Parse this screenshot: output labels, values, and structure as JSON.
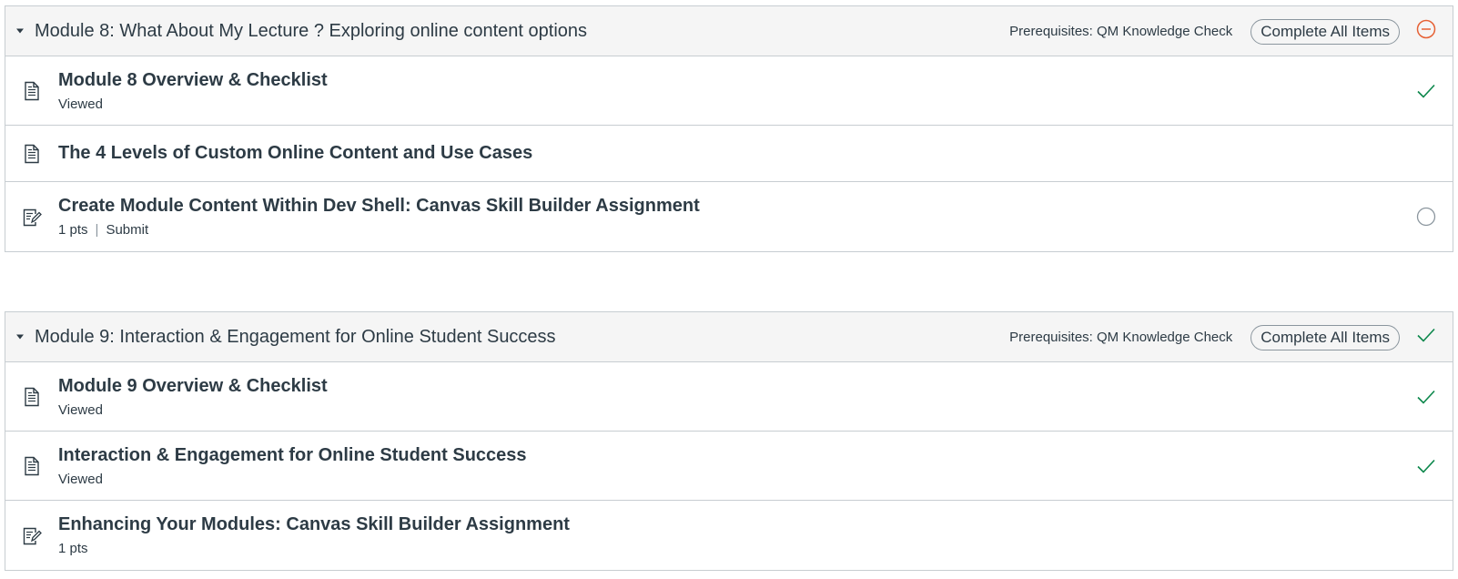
{
  "colors": {
    "complete": "#0b874b",
    "warning": "#e66135",
    "header_bg": "#f5f5f5",
    "border": "#c7cdd1",
    "text": "#2d3b45"
  },
  "modules": [
    {
      "title": "Module 8: What About My Lecture ? Exploring online content options",
      "prerequisites": "Prerequisites: QM Knowledge Check",
      "requirement": "Complete All Items",
      "status_icon": "minus-circle-icon",
      "items": [
        {
          "title": "Module 8 Overview & Checklist",
          "status_text": "Viewed",
          "type_icon": "page-icon",
          "status_icon": "checkmark-icon"
        },
        {
          "title": "The 4 Levels of Custom Online Content and Use Cases",
          "type_icon": "page-icon"
        },
        {
          "title": "Create Module Content Within Dev Shell: Canvas Skill Builder Assignment",
          "points": "1 pts",
          "separator": "|",
          "action": "Submit",
          "type_icon": "assignment-icon",
          "status_icon": "empty-circle-icon"
        }
      ]
    },
    {
      "title": "Module 9: Interaction & Engagement for Online Student Success",
      "prerequisites": "Prerequisites: QM Knowledge Check",
      "requirement": "Complete All Items",
      "status_icon": "checkmark-icon",
      "items": [
        {
          "title": "Module 9 Overview & Checklist",
          "status_text": "Viewed",
          "type_icon": "page-icon",
          "status_icon": "checkmark-icon"
        },
        {
          "title": "Interaction & Engagement for Online Student Success",
          "status_text": "Viewed",
          "type_icon": "page-icon",
          "status_icon": "checkmark-icon"
        },
        {
          "title": "Enhancing Your Modules: Canvas Skill Builder Assignment",
          "points": "1 pts",
          "type_icon": "assignment-icon"
        }
      ]
    }
  ]
}
